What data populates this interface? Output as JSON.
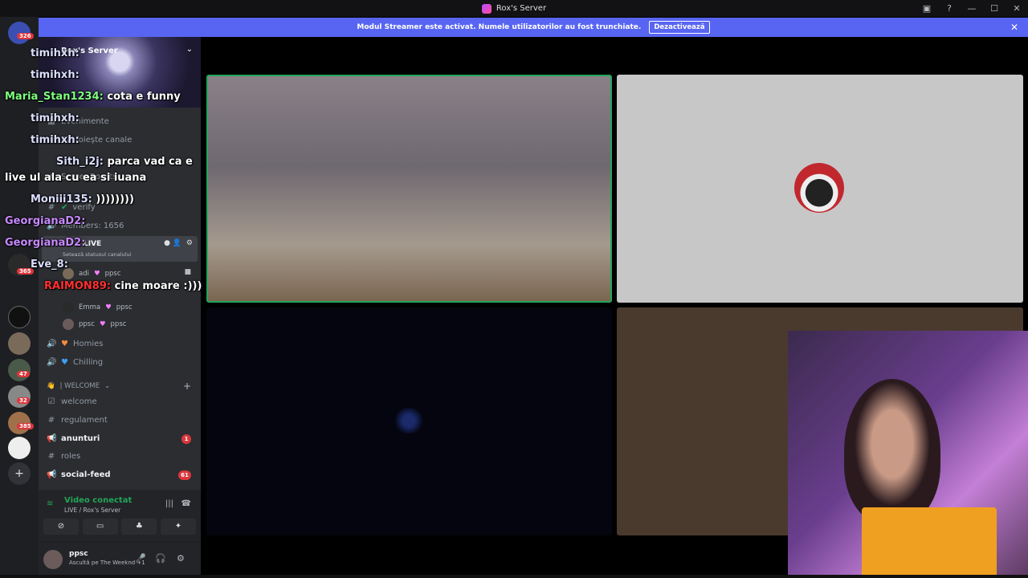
{
  "window": {
    "title": "Rox's Server",
    "controls": [
      "inbox-icon",
      "help-icon",
      "minimize-icon",
      "maximize-icon",
      "close-icon"
    ]
  },
  "banner": {
    "text": "Modul Streamer este activat. Numele utilizatorilor au fost trunchiate.",
    "button": "Dezactivează"
  },
  "server": {
    "name": "Rox's Server",
    "badges": [
      "326",
      "365",
      "47",
      "32",
      "385"
    ]
  },
  "channels": {
    "events": "Evenimente",
    "browse": "Răsfoiește canale",
    "boosts": "Server Boosts",
    "verify": "verify",
    "members": "Members: 1656",
    "live": "LIVE",
    "live_status": "Setează statusul canalului",
    "voice_users": [
      {
        "name": "adi",
        "tag": "ppsc"
      },
      {
        "name": "Emma",
        "tag": "ppsc"
      },
      {
        "name": "ppsc",
        "tag": "ppsc"
      }
    ],
    "homies": "Homies",
    "chilling": "Chilling",
    "category": "| WELCOME",
    "list": [
      {
        "label": "welcome",
        "bold": false
      },
      {
        "label": "regulament",
        "bold": false
      },
      {
        "label": "anunturi",
        "bold": true,
        "badge": "1"
      },
      {
        "label": "roles",
        "bold": false
      },
      {
        "label": "social-feed",
        "bold": true,
        "badge": "61"
      }
    ]
  },
  "voice_panel": {
    "status": "Video conectat",
    "sub": "LIVE / Rox's Server"
  },
  "user_panel": {
    "name": "ppsc",
    "activity": "Ascultă pe The Weeknd +1"
  },
  "chat": [
    {
      "name": "timihxh:",
      "text": "",
      "color": "default"
    },
    {
      "name": "timihxh:",
      "text": "",
      "color": "default"
    },
    {
      "name": "Maria_Stan1234:",
      "text": "cota e funny",
      "color": "green"
    },
    {
      "name": "timihxh:",
      "text": "",
      "color": "default"
    },
    {
      "name": "timihxh:",
      "text": "",
      "color": "default"
    },
    {
      "name": "Sith_i2j:",
      "text": "parca vad ca e",
      "color": "default"
    },
    {
      "name": "",
      "text": "live ul ala cu ea si iuana",
      "color": "default"
    },
    {
      "name": "Moniii135:",
      "text": "))))))))",
      "color": "default"
    },
    {
      "name": "GeorgianaD2:",
      "text": "",
      "color": "purple"
    },
    {
      "name": "GeorgianaD2:",
      "text": "",
      "color": "purple"
    },
    {
      "name": "Eve_8:",
      "text": "",
      "color": "default"
    },
    {
      "name": "RAIMON89:",
      "text": "cine moare :)))",
      "color": "red"
    }
  ],
  "colors": {
    "accent": "#5865f2",
    "speaking": "#23a559",
    "badge": "#da373c"
  }
}
